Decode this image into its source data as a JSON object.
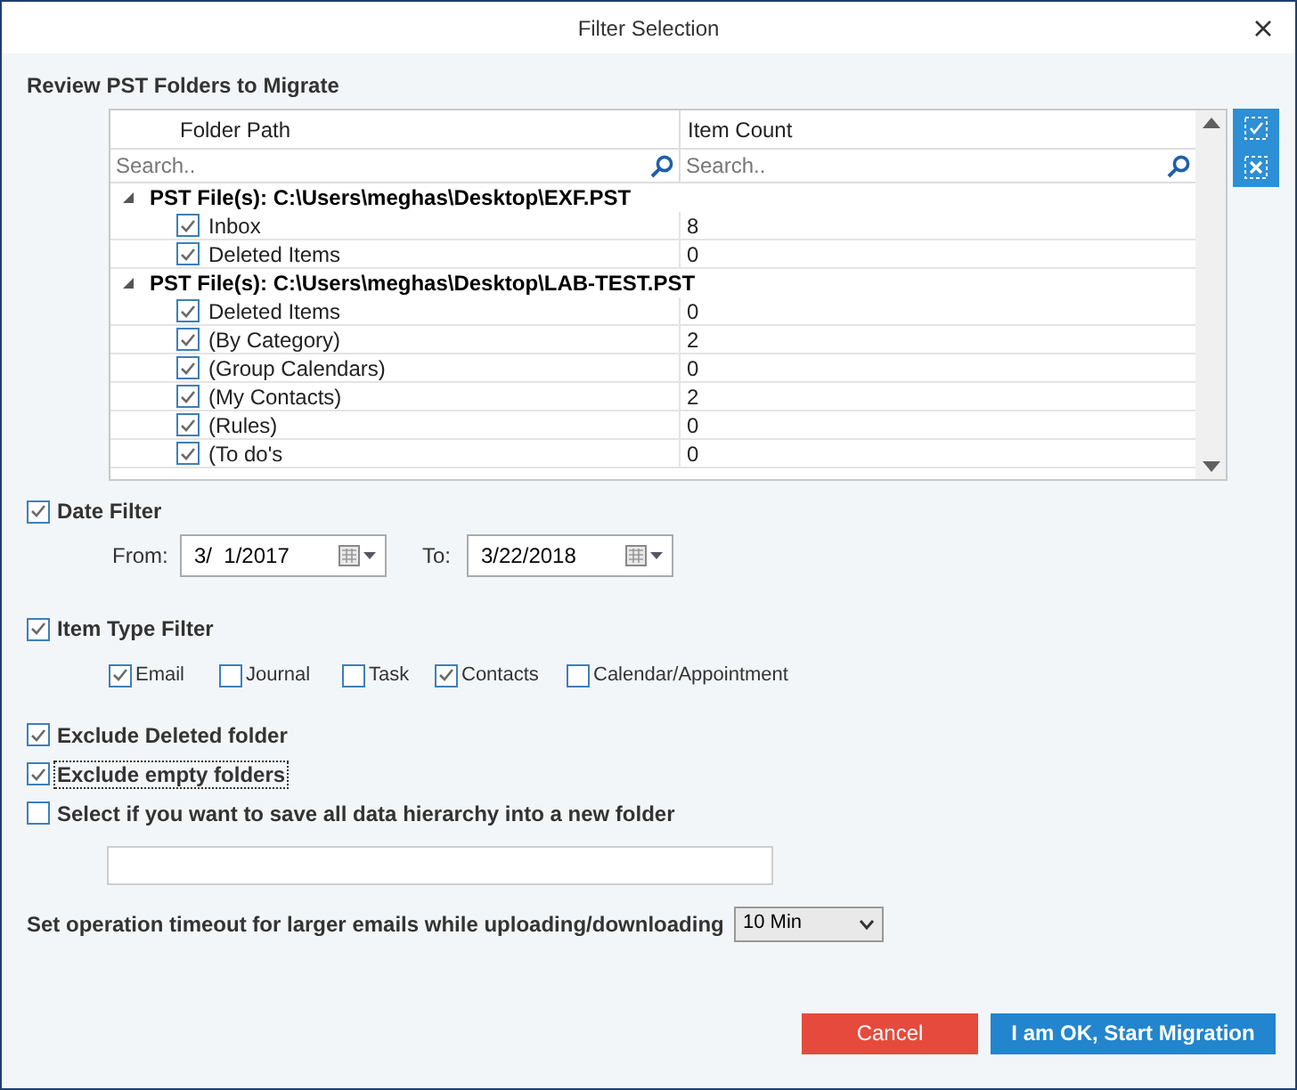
{
  "window": {
    "title": "Filter Selection"
  },
  "section_title": "Review PST Folders to Migrate",
  "grid": {
    "columns": [
      {
        "label": "Folder Path",
        "placeholder": "Search.."
      },
      {
        "label": "Item Count",
        "placeholder": "Search.."
      }
    ],
    "groups": [
      {
        "label": "PST File(s): C:\\Users\\meghas\\Desktop\\EXF.PST",
        "expanded": true,
        "children": [
          {
            "name": "Inbox",
            "count": "8",
            "checked": true
          },
          {
            "name": "Deleted Items",
            "count": "0",
            "checked": true
          }
        ]
      },
      {
        "label": "PST File(s): C:\\Users\\meghas\\Desktop\\LAB-TEST.PST",
        "expanded": true,
        "children": [
          {
            "name": "Deleted Items",
            "count": "0",
            "checked": true
          },
          {
            "name": "(By Category)",
            "count": "2",
            "checked": true
          },
          {
            "name": "(Group Calendars)",
            "count": "0",
            "checked": true
          },
          {
            "name": "(My Contacts)",
            "count": "2",
            "checked": true
          },
          {
            "name": "(Rules)",
            "count": "0",
            "checked": true
          },
          {
            "name": "(To do's",
            "count": "0",
            "checked": true
          }
        ]
      }
    ]
  },
  "date_filter": {
    "label": "Date Filter",
    "checked": true,
    "from_label": "From:",
    "from": "3/  1/2017",
    "to_label": "To:",
    "to": "3/22/2018"
  },
  "item_type_filter": {
    "label": "Item Type Filter",
    "checked": true,
    "types": [
      {
        "label": "Email",
        "checked": true
      },
      {
        "label": "Journal",
        "checked": false
      },
      {
        "label": "Task",
        "checked": false
      },
      {
        "label": "Contacts",
        "checked": true
      },
      {
        "label": "Calendar/Appointment",
        "checked": false
      }
    ]
  },
  "options": [
    {
      "label": "Exclude Deleted folder",
      "checked": true,
      "focused": false
    },
    {
      "label": "Exclude empty folders",
      "checked": true,
      "focused": true
    },
    {
      "label": "Select if you want to save all data hierarchy into a new folder",
      "checked": false,
      "focused": false
    }
  ],
  "timeout": {
    "label": "Set operation timeout for larger emails while uploading/downloading",
    "value": "10 Min"
  },
  "buttons": [
    {
      "label": "Cancel",
      "kind": "cancel"
    },
    {
      "label": "I am OK, Start Migration",
      "kind": "primary"
    }
  ]
}
